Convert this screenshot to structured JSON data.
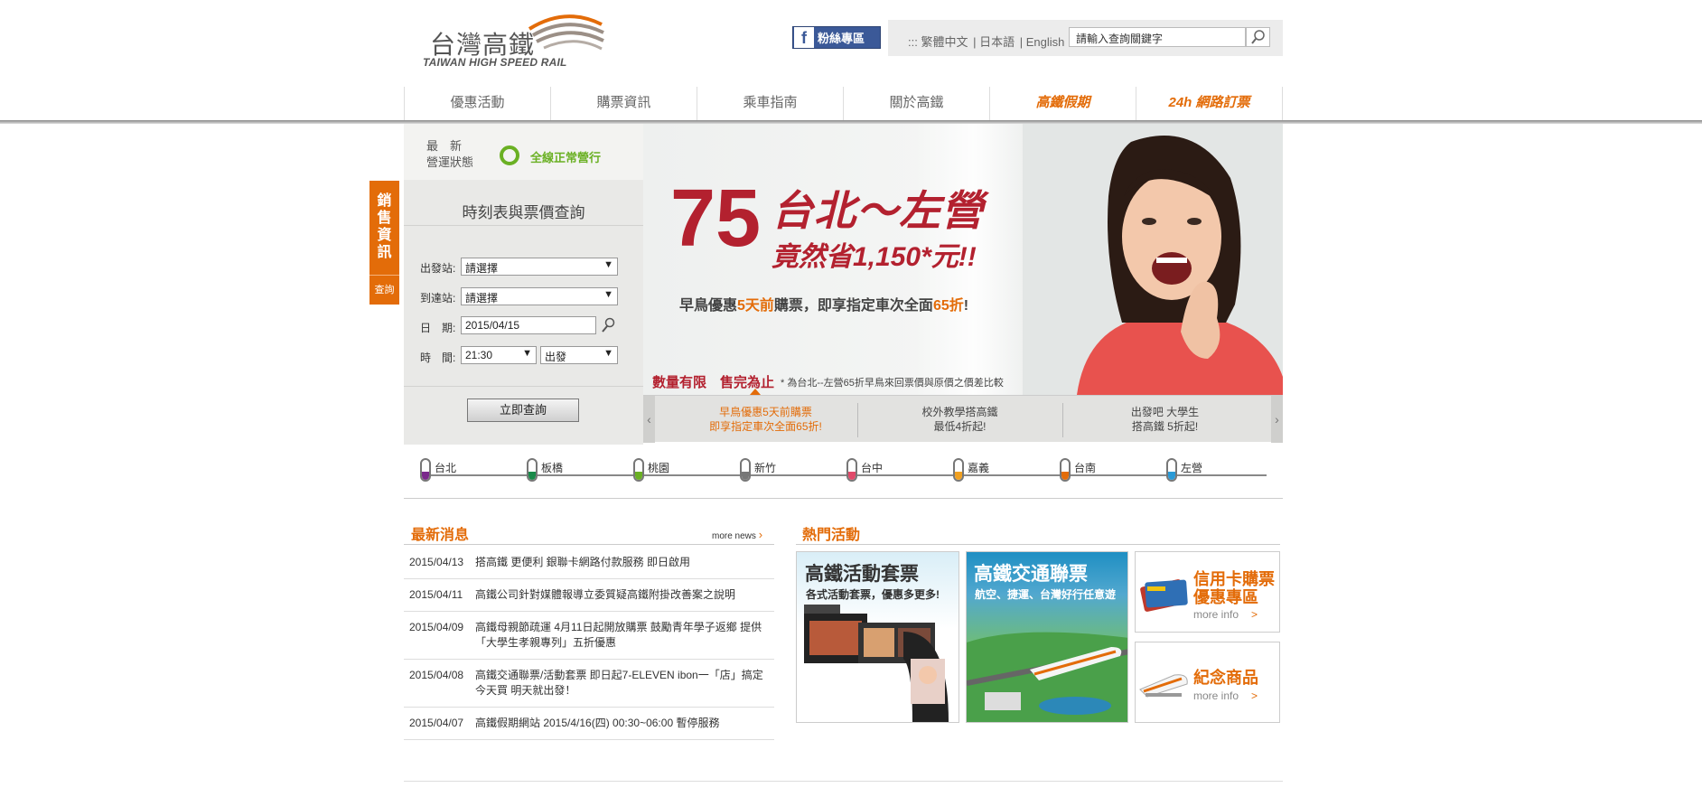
{
  "header": {
    "logo_cn": "台灣高鐵",
    "logo_en": "TAIWAN HIGH SPEED RAIL",
    "fb_label": "粉絲專區",
    "languages": [
      "::: 繁體中文",
      "日本語",
      "English"
    ],
    "search_placeholder": "請輸入查詢關鍵字"
  },
  "nav": {
    "items": [
      "優惠活動",
      "購票資訊",
      "乘車指南",
      "關於高鐵",
      "高鐵假期",
      "24h 網路訂票"
    ]
  },
  "side_tab": {
    "label": "銷售資訊",
    "query": "查詢"
  },
  "status": {
    "label": "最　新\n營運狀態",
    "text": "全線正常營行"
  },
  "form": {
    "title": "時刻表與票價查詢",
    "from_label": "出發站:",
    "from_value": "請選擇",
    "to_label": "到達站:",
    "to_value": "請選擇",
    "date_label": "日　期:",
    "date_value": "2015/04/15",
    "time_label": "時　間:",
    "time_value": "21:30",
    "time_type": "出發",
    "submit": "立即查詢"
  },
  "banner": {
    "big": "75",
    "title": "台北～左營",
    "subtitle": "竟然省1,150*元!!",
    "line_pre": "早鳥優惠",
    "line_hl1": "5天前",
    "line_mid": "購票，即享指定車次全面",
    "line_hl2": "65折",
    "line_end": "!",
    "limit": "數量有限　售完為止",
    "note": "* 為台北--左營65折早鳥來回票價與原價之價差比較"
  },
  "slider": {
    "items": [
      {
        "line1": "早鳥優惠5天前購票",
        "line2": "即享指定車次全面65折!"
      },
      {
        "line1": "校外教學搭高鐵",
        "line2": "最低4折起!"
      },
      {
        "line1": "出發吧 大學生",
        "line2": "搭高鐵 5折起!"
      }
    ]
  },
  "stations": [
    {
      "name": "台北",
      "color": "#7b2a8c"
    },
    {
      "name": "板橋",
      "color": "#1a8a4a"
    },
    {
      "name": "桃園",
      "color": "#6ab023"
    },
    {
      "name": "新竹",
      "color": "#777777"
    },
    {
      "name": "台中",
      "color": "#e04a6a"
    },
    {
      "name": "嘉義",
      "color": "#f0a020"
    },
    {
      "name": "台南",
      "color": "#e36c09"
    },
    {
      "name": "左營",
      "color": "#2a9ad6"
    }
  ],
  "news": {
    "title": "最新消息",
    "more": "more news",
    "items": [
      {
        "date": "2015/04/13",
        "text": "搭高鐵 更便利 銀聯卡網路付款服務 即日啟用"
      },
      {
        "date": "2015/04/11",
        "text": "高鐵公司針對媒體報導立委質疑高鐵附掛改善案之說明"
      },
      {
        "date": "2015/04/09",
        "text": "高鐵母親節疏運 4月11日起開放購票 鼓勵青年學子返鄉 提供「大學生孝親專列」五折優惠"
      },
      {
        "date": "2015/04/08",
        "text": "高鐵交通聯票/活動套票 即日起7-ELEVEN ibon一「店」搞定 今天買 明天就出發！"
      },
      {
        "date": "2015/04/07",
        "text": "高鐵假期網站 2015/4/16(四) 00:30~06:00 暫停服務"
      }
    ]
  },
  "events": {
    "title": "熱門活動",
    "card1_title": "高鐵活動套票",
    "card1_sub": "各式活動套票，優惠多更多!",
    "card2_title": "高鐵交通聯票",
    "card2_sub": "航空、捷運、台灣好行任意遊",
    "card3_title": "信用卡購票\n優惠專區",
    "card3_more": "more info",
    "card4_title": "紀念商品",
    "card4_more": "more info"
  }
}
